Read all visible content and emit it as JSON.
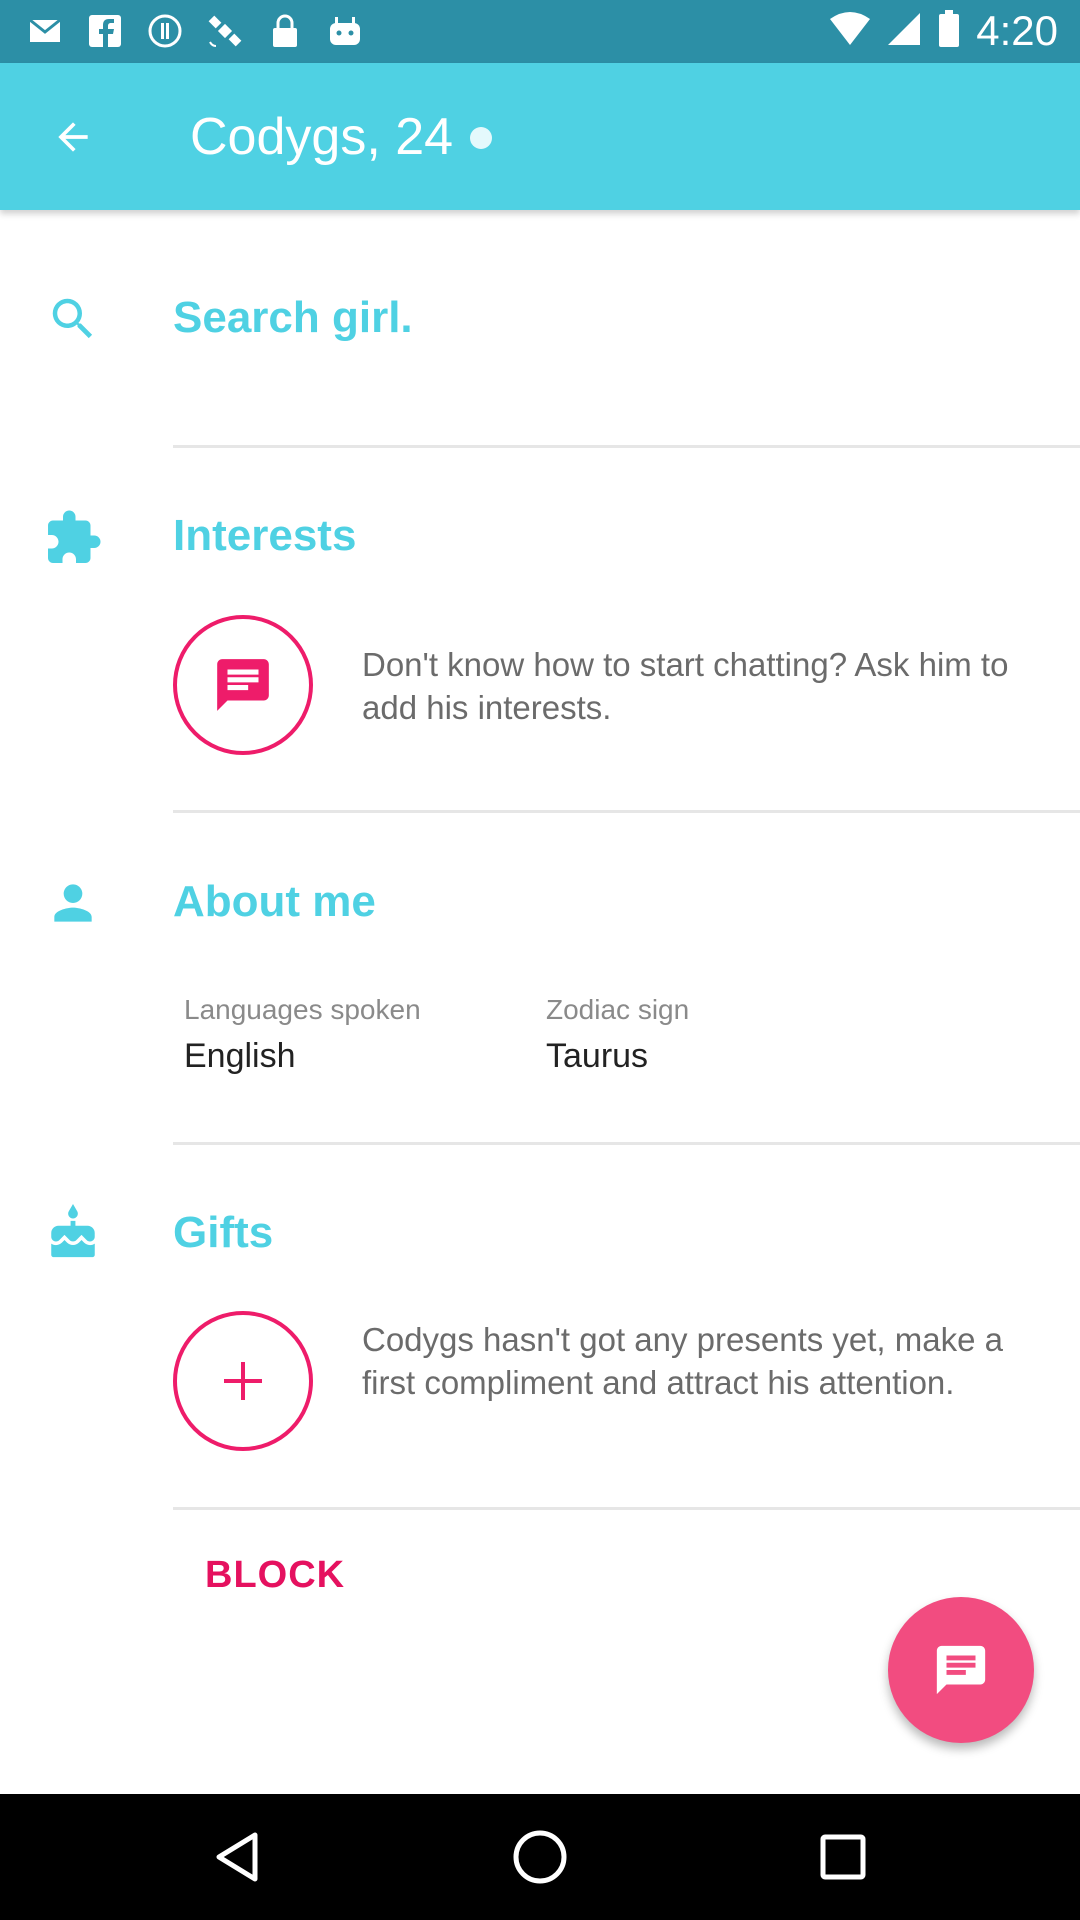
{
  "status_bar": {
    "time": "4:20",
    "icons": [
      "email-icon",
      "facebook-icon",
      "alert-icon",
      "satellite-icon",
      "lock-icon",
      "android-icon"
    ],
    "right_icons": [
      "wifi-icon",
      "signal-icon",
      "battery-icon"
    ]
  },
  "app_bar": {
    "title": "Codygs, 24",
    "back_icon": "back-arrow-icon"
  },
  "search": {
    "label": "Search girl.",
    "icon": "search-icon"
  },
  "interests": {
    "title": "Interests",
    "icon": "puzzle-icon",
    "message": "Don't know how to start chatting? Ask him to add his interests."
  },
  "about": {
    "title": "About me",
    "icon": "person-icon",
    "fields": [
      {
        "label": "Languages spoken",
        "value": "English"
      },
      {
        "label": "Zodiac sign",
        "value": "Taurus"
      }
    ]
  },
  "gifts": {
    "title": "Gifts",
    "icon": "cake-icon",
    "message": "Codygs hasn't got any presents yet, make a first compliment and attract his attention."
  },
  "block_label": "BLOCK",
  "colors": {
    "accent": "#4fd1e3",
    "status_bar": "#2c8fa6",
    "pink": "#ee1c6a",
    "fab": "#f24c80"
  }
}
